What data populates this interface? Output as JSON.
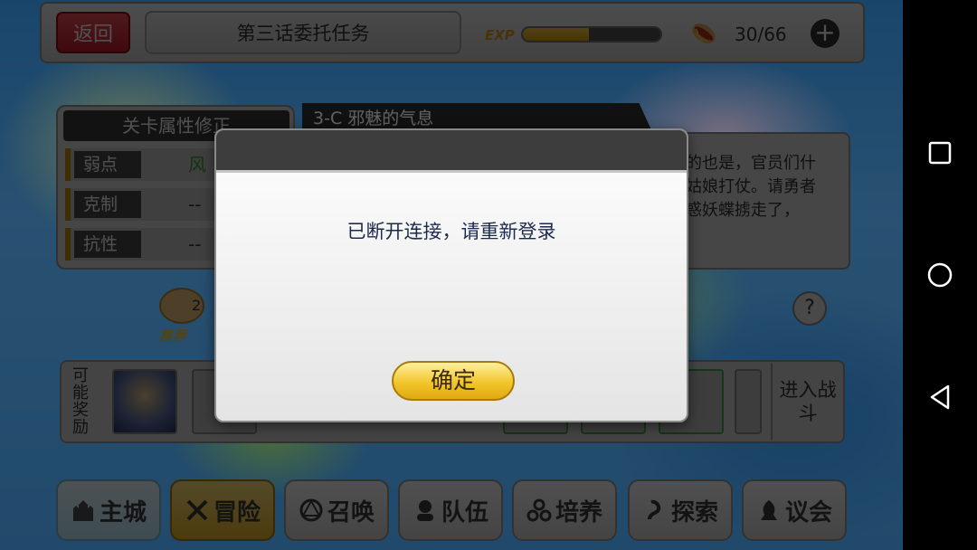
{
  "top_bar": {
    "back_label": "返回",
    "title": "第三话委托任务",
    "exp_label": "EXP",
    "exp_progress": 0.48,
    "stamina": "30/66",
    "plus_label": "+"
  },
  "attributes": {
    "title": "关卡属性修正",
    "rows": [
      {
        "key": "弱点",
        "value": "风"
      },
      {
        "key": "克制",
        "value": "--"
      },
      {
        "key": "抗性",
        "value": "--"
      }
    ]
  },
  "stage": {
    "name": "3-C  邪魅的气息",
    "description": "的也是，官员们什\n姑娘打仗。请勇者\n惑妖蝶掳走了，"
  },
  "recommend": {
    "count": "2",
    "label": "推荐"
  },
  "help_label": "?",
  "rewards": {
    "label": "可能奖励",
    "enter_label": "进入战斗"
  },
  "nav": [
    {
      "label": "主城",
      "icon": "castle-icon"
    },
    {
      "label": "冒险",
      "icon": "crossed-swords-icon"
    },
    {
      "label": "召唤",
      "icon": "summon-circle-icon"
    },
    {
      "label": "队伍",
      "icon": "team-icon"
    },
    {
      "label": "培养",
      "icon": "train-icon"
    },
    {
      "label": "探索",
      "icon": "explore-icon"
    },
    {
      "label": "议会",
      "icon": "council-icon"
    }
  ],
  "dialog": {
    "message": "已断开连接，请重新登录",
    "ok_label": "确定"
  },
  "colors": {
    "accent_yellow": "#f2c62b",
    "back_red": "#d62d37",
    "dialog_text": "#1c2a4c"
  }
}
